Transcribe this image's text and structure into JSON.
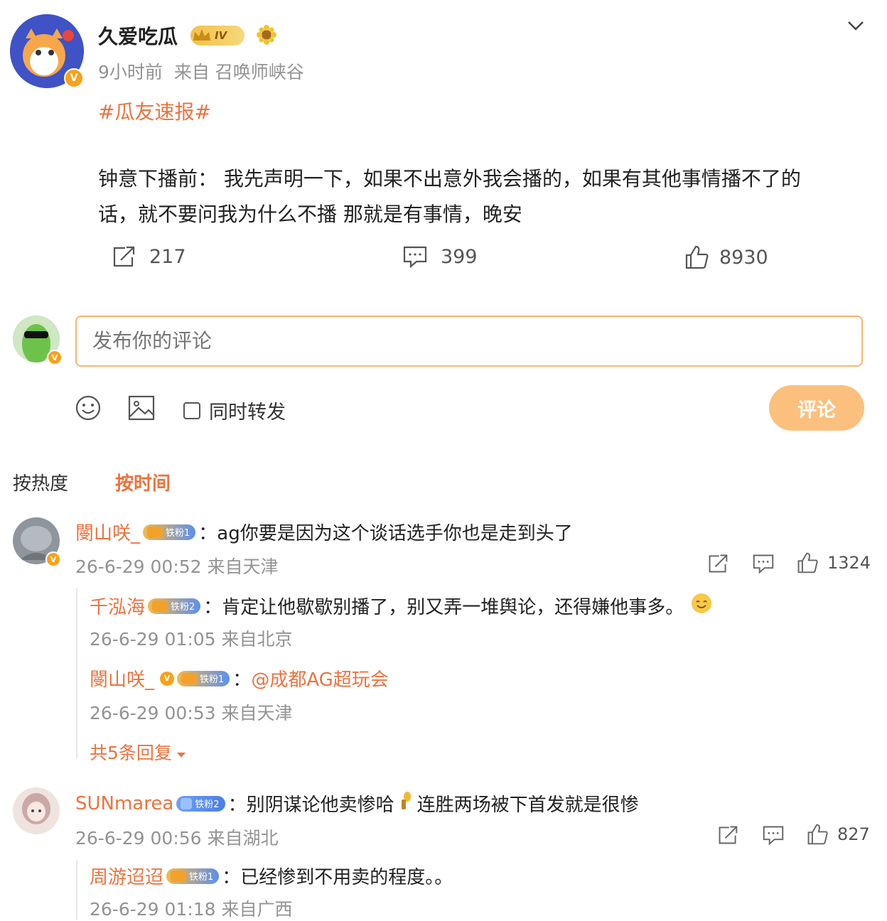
{
  "post": {
    "author": "久爱吃瓜",
    "level_badge": "IV",
    "meta_time": "9小时前",
    "meta_source": "来自 召唤师峡谷",
    "topic": "#瓜友速报#",
    "content_line1": "钟意下播前： 我先声明一下，如果不出意外我会播的，如果有其他事情播不了的",
    "content_line2": "话，就不要问我为什么不播 那就是有事情，晚安",
    "repost_count": "217",
    "comment_count": "399",
    "like_count": "8930"
  },
  "compose": {
    "placeholder": "发布你的评论",
    "also_repost_label": "同时转发",
    "submit_label": "评论"
  },
  "sort": {
    "by_hot": "按热度",
    "by_time": "按时间"
  },
  "comments": [
    {
      "user": "閿山咲_",
      "fan_badge": "铁粉1",
      "text": "：ag你要是因为这个谈话选手你也是走到头了",
      "meta": "26-6-29 00:52 来自天津",
      "likes": "1324",
      "replies": [
        {
          "user": "千泓海",
          "fan_badge": "铁粉2",
          "text": "：肯定让他歇歇别播了，别又弄一堆舆论，还得嫌他事多。",
          "meta": "26-6-29 01:05 来自北京"
        },
        {
          "user": "閿山咲_",
          "fan_badge": "铁粉1",
          "colon": "：",
          "mention": "@成都AG超玩会",
          "meta": "26-6-29 00:53 来自天津"
        }
      ],
      "more_replies": "共5条回复"
    },
    {
      "user": "SUNmarea",
      "fan_badge": "铁粉2",
      "text_a": "：别阴谋论他卖惨哈",
      "text_b": "连胜两场被下首发就是很惨",
      "meta": "26-6-29 00:56 来自湖北",
      "likes": "827",
      "replies": [
        {
          "user": "周游迢迢",
          "fan_badge": "铁粉1",
          "text": "：已经惨到不用卖的程度。。",
          "meta": "26-6-29 01:18 来自广西"
        }
      ]
    }
  ],
  "colors": {
    "accent_orange": "#eb7340",
    "button_orange": "#fbc07e",
    "input_border": "#f7b56f",
    "meta_gray": "#939393"
  }
}
